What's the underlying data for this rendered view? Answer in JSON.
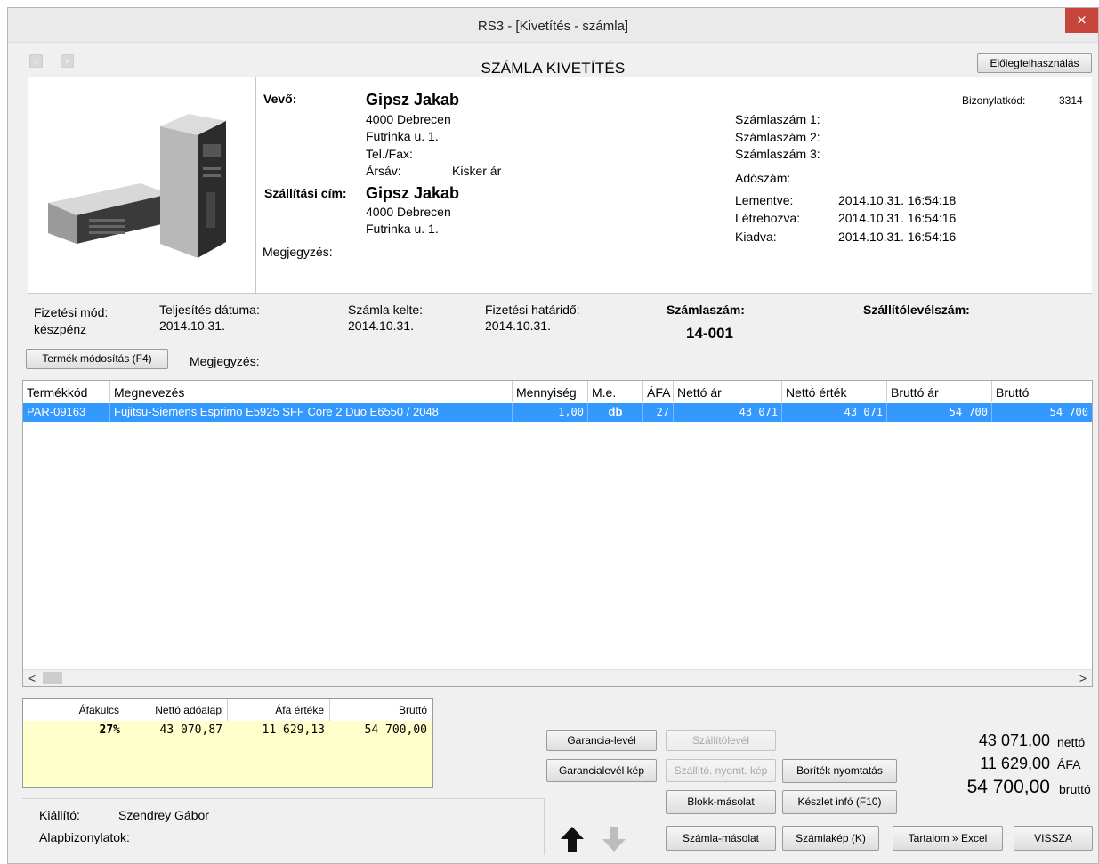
{
  "window": {
    "title": "RS3 - [Kivetítés - számla]",
    "close_glyph": "×"
  },
  "header": {
    "heading": "SZÁMLA KIVETÍTÉS",
    "nav_back": "‹",
    "nav_forward": "›",
    "advance_button": "Előlegfelhasználás"
  },
  "buyer": {
    "label": "Vevő:",
    "name": "Gipsz Jakab",
    "address1": "4000 Debrecen",
    "address2": "Futrinka u. 1.",
    "phone_label": "Tel./Fax:",
    "price_band_label": "Ársáv:",
    "price_band_value": "Kisker ár"
  },
  "shipping": {
    "label": "Szállítási cím:",
    "name": "Gipsz Jakab",
    "address1": "4000 Debrecen",
    "address2": "Futrinka u. 1."
  },
  "note_label": "Megjegyzés:",
  "doc_info": {
    "code_label": "Bizonylatkód:",
    "code_value": "3314",
    "invoice_no1": "Számlaszám 1:",
    "invoice_no2": "Számlaszám 2:",
    "invoice_no3": "Számlaszám 3:",
    "tax_no_label": "Adószám:",
    "saved_label": "Lementve:",
    "saved_value": "2014.10.31. 16:54:18",
    "created_label": "Létrehozva:",
    "created_value": "2014.10.31. 16:54:16",
    "issued_label": "Kiadva:",
    "issued_value": "2014.10.31. 16:54:16"
  },
  "payment": {
    "method_label": "Fizetési mód:",
    "method_value": "készpénz",
    "fulfil_label": "Teljesítés dátuma:",
    "fulfil_value": "2014.10.31.",
    "date_label": "Számla kelte:",
    "date_value": "2014.10.31.",
    "due_label": "Fizetési határidő:",
    "due_value": "2014.10.31.",
    "invoice_no_label": "Számlaszám:",
    "invoice_no_value": "14-001",
    "delivery_note_label": "Szállítólevélszám:"
  },
  "product_edit_button": "Termék módosítás (F4)",
  "product_note_label": "Megjegyzés:",
  "grid": {
    "headers": [
      "Termékkód",
      "Megnevezés",
      "Mennyiség",
      "M.e.",
      "ÁFA",
      "Nettó ár",
      "Nettó érték",
      "Bruttó ár",
      "Bruttó"
    ],
    "rows": [
      [
        "PAR-09163",
        "Fujitsu-Siemens Esprimo E5925 SFF Core 2 Duo E6550 / 2048",
        "1,00",
        "db",
        "27",
        "43 071",
        "43 071",
        "54 700",
        "54 700"
      ]
    ],
    "scroll_left": "<",
    "scroll_right": ">"
  },
  "vat_table": {
    "headers": [
      "Áfakulcs",
      "Nettó adóalap",
      "Áfa értéke",
      "Bruttó"
    ],
    "row": [
      "27%",
      "43 070,87",
      "11 629,13",
      "54 700,00"
    ]
  },
  "issuer": {
    "label": "Kiállító:",
    "value": "Szendrey Gábor",
    "base_docs_label": "Alapbizonylatok:",
    "base_docs_value": "_"
  },
  "buttons": {
    "guarantee": "Garancia-levél",
    "guarantee_img": "Garancialevél kép",
    "delivery_note": "Szállítólevél",
    "delivery_print_img": "Szállító. nyomt. kép",
    "envelope_print": "Boríték nyomtatás",
    "block_copy": "Blokk-másolat",
    "stock_info": "Készlet infó (F10)",
    "invoice_copy": "Számla-másolat",
    "invoice_image": "Számlakép (K)",
    "content_excel": "Tartalom » Excel",
    "back": "VISSZA"
  },
  "totals": {
    "net": "43 071,00",
    "net_unit": "nettó",
    "vat": "11 629,00",
    "vat_unit": "ÁFA",
    "gross": "54 700,00",
    "gross_unit": "bruttó"
  }
}
